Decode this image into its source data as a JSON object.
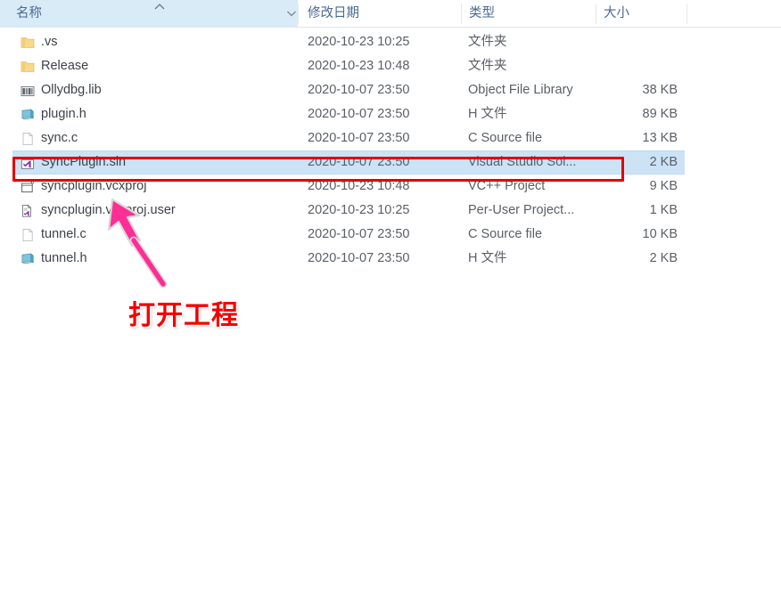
{
  "columns": {
    "name": {
      "label": "名称",
      "sorted": true,
      "sort_direction": "ascending"
    },
    "date": {
      "label": "修改日期"
    },
    "type": {
      "label": "类型"
    },
    "size": {
      "label": "大小"
    }
  },
  "files": [
    {
      "name": ".vs",
      "date": "2020-10-23 10:25",
      "type": "文件夹",
      "size": "",
      "icon": "folder-icon",
      "selected": false
    },
    {
      "name": "Release",
      "date": "2020-10-23 10:48",
      "type": "文件夹",
      "size": "",
      "icon": "folder-icon",
      "selected": false
    },
    {
      "name": "Ollydbg.lib",
      "date": "2020-10-07 23:50",
      "type": "Object File Library",
      "size": "38 KB",
      "icon": "library-icon",
      "selected": false
    },
    {
      "name": "plugin.h",
      "date": "2020-10-07 23:50",
      "type": "H 文件",
      "size": "89 KB",
      "icon": "header-file-icon",
      "selected": false
    },
    {
      "name": "sync.c",
      "date": "2020-10-07 23:50",
      "type": "C Source file",
      "size": "13 KB",
      "icon": "blank-document-icon",
      "selected": false
    },
    {
      "name": "SyncPlugin.sln",
      "date": "2020-10-07 23:50",
      "type": "Visual Studio Sol...",
      "size": "2 KB",
      "icon": "vs-solution-icon",
      "selected": true
    },
    {
      "name": "syncplugin.vcxproj",
      "date": "2020-10-23 10:48",
      "type": "VC++ Project",
      "size": "9 KB",
      "icon": "vcxproj-icon",
      "selected": false
    },
    {
      "name": "syncplugin.vcxproj.user",
      "date": "2020-10-23 10:25",
      "type": "Per-User Project...",
      "size": "1 KB",
      "icon": "vs-user-file-icon",
      "selected": false
    },
    {
      "name": "tunnel.c",
      "date": "2020-10-07 23:50",
      "type": "C Source file",
      "size": "10 KB",
      "icon": "blank-document-icon",
      "selected": false
    },
    {
      "name": "tunnel.h",
      "date": "2020-10-07 23:50",
      "type": "H 文件",
      "size": "2 KB",
      "icon": "header-file-icon",
      "selected": false
    }
  ],
  "annotations": {
    "callout_text": "打开工程",
    "callout_color": "#f50000",
    "highlight_box_color": "#e50000",
    "arrow_color": "#ff2d96",
    "target_row": "SyncPlugin.sln"
  },
  "colors": {
    "header_highlight": "#d9ebf7",
    "selection": "#cce3f6",
    "header_text": "#4a6a92",
    "row_text": "#3e4247"
  }
}
